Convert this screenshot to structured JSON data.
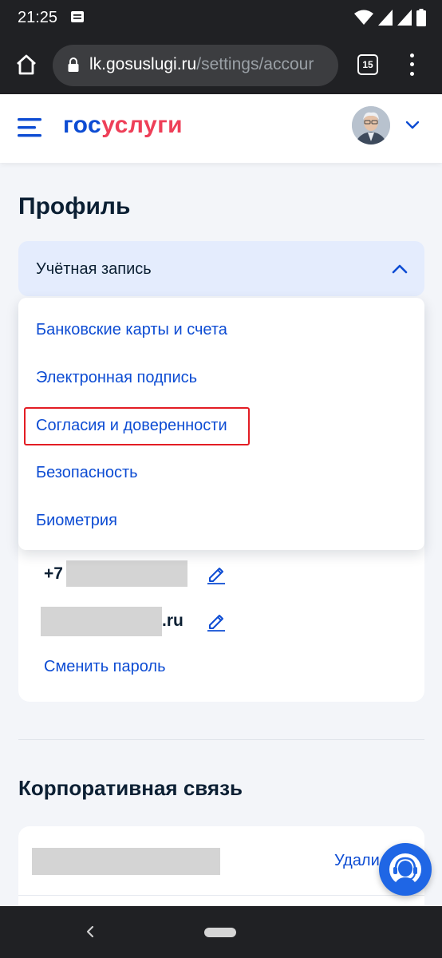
{
  "status_bar": {
    "time": "21:25",
    "icons": [
      "notification-icon",
      "wifi-icon",
      "signal-icon",
      "signal-icon",
      "battery-icon"
    ]
  },
  "browser": {
    "url_domain": "lk.gosuslugi.ru",
    "url_path": "/settings/accour",
    "tabs_count": "15"
  },
  "header": {
    "logo_part1": "гос",
    "logo_part2": "услуги"
  },
  "page": {
    "title": "Профиль",
    "account_section": "Учётная запись"
  },
  "dropdown": {
    "items": [
      "Банковские карты и счета",
      "Электронная подпись",
      "Согласия и доверенности",
      "Безопасность",
      "Биометрия"
    ],
    "highlighted_index": 2
  },
  "contacts": {
    "phone_prefix": "+7",
    "email_suffix": ".ru",
    "change_password": "Сменить пароль"
  },
  "corporate": {
    "title": "Корпоративная связь",
    "delete_label": "Удали"
  },
  "colors": {
    "brand_blue": "#0d4cd3",
    "brand_red": "#ee3f58",
    "highlight_red": "#e31d24",
    "support_blue": "#1f66e5"
  }
}
